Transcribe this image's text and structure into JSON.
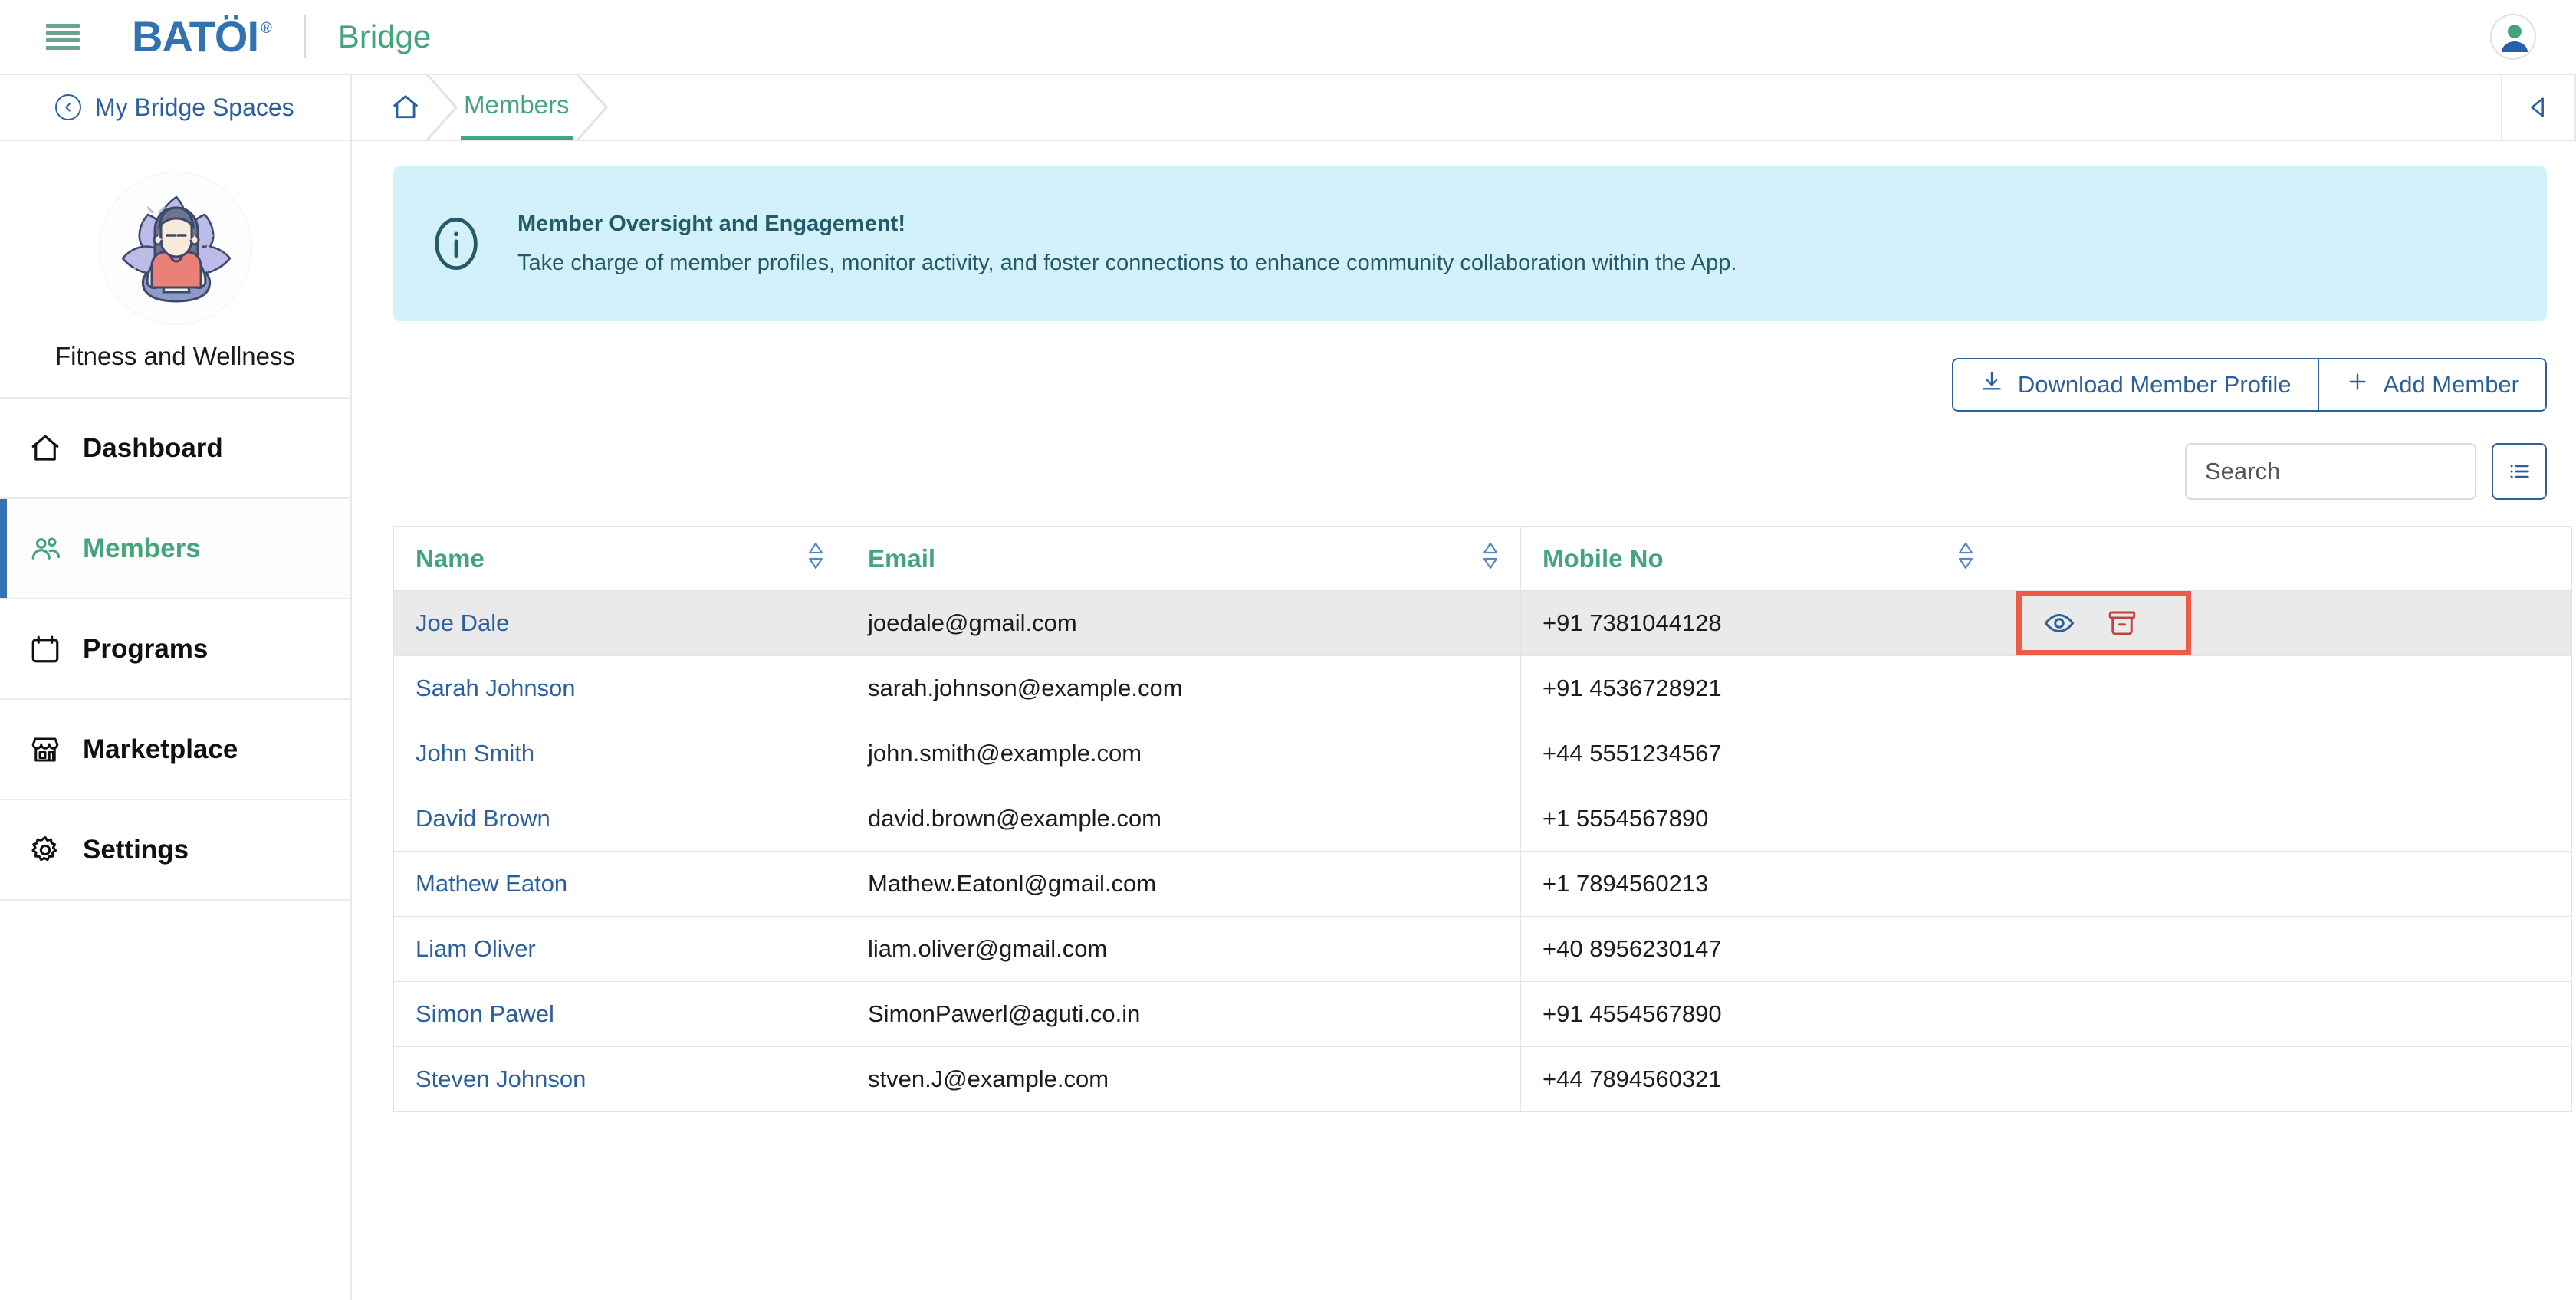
{
  "topbar": {
    "menu_icon": "hamburger-icon",
    "logo_text": "BATÖI",
    "logo_registered": "®",
    "brand_sub": "Bridge",
    "avatar_icon": "user-avatar-icon"
  },
  "sidebar": {
    "back_label": "My Bridge Spaces",
    "space_name": "Fitness and Wellness",
    "space_avatar_icon": "yoga-meditation-avatar",
    "items": [
      {
        "label": "Dashboard",
        "icon": "home-icon",
        "active": false
      },
      {
        "label": "Members",
        "icon": "users-icon",
        "active": true
      },
      {
        "label": "Programs",
        "icon": "calendar-icon",
        "active": false
      },
      {
        "label": "Marketplace",
        "icon": "store-icon",
        "active": false
      },
      {
        "label": "Settings",
        "icon": "gear-icon",
        "active": false
      }
    ]
  },
  "breadcrumb": {
    "home_icon": "home-icon",
    "current": "Members",
    "collapse_icon": "chevron-left-icon"
  },
  "banner": {
    "icon": "info-circle-icon",
    "title": "Member Oversight and Engagement!",
    "description": "Take charge of member profiles, monitor activity, and foster connections to enhance community collaboration within the App."
  },
  "toolbar": {
    "download_label": "Download Member Profile",
    "download_icon": "download-icon",
    "add_label": "Add Member",
    "add_icon": "plus-icon"
  },
  "search": {
    "value": "",
    "placeholder": "Search",
    "list_view_icon": "list-view-icon"
  },
  "table": {
    "columns": [
      {
        "label": "Name",
        "sortable": true,
        "sort_icon": "sort-updown-icon"
      },
      {
        "label": "Email",
        "sortable": true,
        "sort_icon": "sort-updown-icon"
      },
      {
        "label": "Mobile No",
        "sortable": true,
        "sort_icon": "sort-updown-icon"
      },
      {
        "label": "",
        "sortable": false
      }
    ],
    "rows": [
      {
        "name": "Joe Dale",
        "email": "joedale@gmail.com",
        "mobile": "+91 7381044128",
        "highlighted": true,
        "has_actions": true
      },
      {
        "name": "Sarah Johnson",
        "email": "sarah.johnson@example.com",
        "mobile": "+91 4536728921",
        "highlighted": false,
        "has_actions": false
      },
      {
        "name": "John Smith",
        "email": "john.smith@example.com",
        "mobile": "+44 5551234567",
        "highlighted": false,
        "has_actions": false
      },
      {
        "name": "David Brown",
        "email": "david.brown@example.com",
        "mobile": "+1 5554567890",
        "highlighted": false,
        "has_actions": false
      },
      {
        "name": "Mathew Eaton",
        "email": "Mathew.Eatonl@gmail.com",
        "mobile": "+1 7894560213",
        "highlighted": false,
        "has_actions": false
      },
      {
        "name": "Liam Oliver",
        "email": "liam.oliver@gmail.com",
        "mobile": "+40 8956230147",
        "highlighted": false,
        "has_actions": false
      },
      {
        "name": "Simon Pawel",
        "email": "SimonPawerl@aguti.co.in",
        "mobile": "+91 4554567890",
        "highlighted": false,
        "has_actions": false
      },
      {
        "name": "Steven Johnson",
        "email": "stven.J@example.com",
        "mobile": "+44 7894560321",
        "highlighted": false,
        "has_actions": false
      }
    ],
    "row_actions": [
      {
        "icon": "eye-icon",
        "name": "view"
      },
      {
        "icon": "archive-icon",
        "name": "archive"
      }
    ]
  },
  "colors": {
    "brand_blue": "#3372b0",
    "brand_green": "#44a57c",
    "link_blue": "#2c5f9e",
    "banner_bg": "#d2f1fa",
    "banner_text": "#235b68",
    "highlight_red": "#ef5a46",
    "archive_red": "#c0443c",
    "row_highlight": "#eaeaea"
  }
}
